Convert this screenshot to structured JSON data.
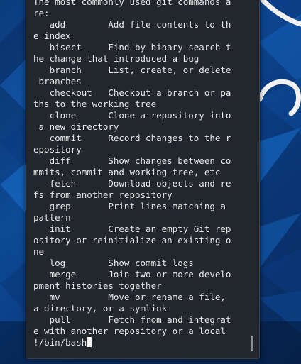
{
  "wallpaper": {
    "colors": [
      "#0a2f63",
      "#0d4a96",
      "#1560b8",
      "#08295a",
      "#1a72d0"
    ],
    "logo": "kali-dragon-logo"
  },
  "terminal": {
    "lines": [
      "The most commonly used git commands a",
      "re:",
      "   add        Add file contents to th",
      "e index",
      "   bisect     Find by binary search t",
      "he change that introduced a bug",
      "   branch     List, create, or delete",
      " branches",
      "   checkout   Checkout a branch or pa",
      "ths to the working tree",
      "   clone      Clone a repository into",
      " a new directory",
      "   commit     Record changes to the r",
      "epository",
      "   diff       Show changes between co",
      "mmits, commit and working tree, etc",
      "   fetch      Download objects and re",
      "fs from another repository",
      "   grep       Print lines matching a",
      "pattern",
      "   init       Create an empty Git rep",
      "ository or reinitialize an existing o",
      "ne",
      "   log        Show commit logs",
      "   merge      Join two or more develo",
      "pment histories together",
      "   mv         Move or rename a file,",
      "a directory, or a symlink",
      "   pull       Fetch from and integrat",
      "e with another repository or a local",
      "!/bin/bash"
    ],
    "scrollbar_position": 1.0,
    "text_color": "#e6e6e6",
    "background_color": "#22272e"
  }
}
